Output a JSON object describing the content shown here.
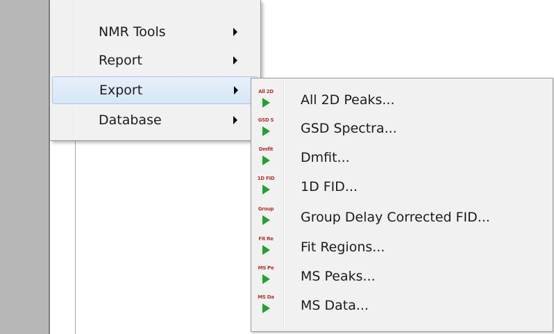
{
  "colors": {
    "menu_bg": "#f1f1f1",
    "highlight_bg": "#d6e6f7",
    "highlight_border": "#a9c6ea",
    "icon_tag": "#b0342a",
    "icon_play": "#1fa22e",
    "left_strip": "#b7b7b7"
  },
  "menu": {
    "items": [
      {
        "label": "NMR Tools",
        "has_submenu": true,
        "highlighted": false
      },
      {
        "label": "Report",
        "has_submenu": true,
        "highlighted": false
      },
      {
        "label": "Export",
        "has_submenu": true,
        "highlighted": true
      },
      {
        "label": "Database",
        "has_submenu": true,
        "highlighted": false
      }
    ]
  },
  "submenu": {
    "parent": "Export",
    "items": [
      {
        "label": "All 2D Peaks...",
        "icon_tag": "All 2D",
        "icon": "export-play-icon"
      },
      {
        "label": "GSD Spectra...",
        "icon_tag": "GSD S",
        "icon": "export-play-icon"
      },
      {
        "label": "Dmfit...",
        "icon_tag": "Dmfit",
        "icon": "export-play-icon"
      },
      {
        "label": "1D FID...",
        "icon_tag": "1D FID",
        "icon": "export-play-icon"
      },
      {
        "label": "Group Delay Corrected FID...",
        "icon_tag": "Group",
        "icon": "export-play-icon"
      },
      {
        "label": "Fit Regions...",
        "icon_tag": "Fit Re",
        "icon": "export-play-icon"
      },
      {
        "label": "MS Peaks...",
        "icon_tag": "MS Pe",
        "icon": "export-play-icon"
      },
      {
        "label": "MS Data...",
        "icon_tag": "MS Da",
        "icon": "export-play-icon"
      }
    ]
  }
}
